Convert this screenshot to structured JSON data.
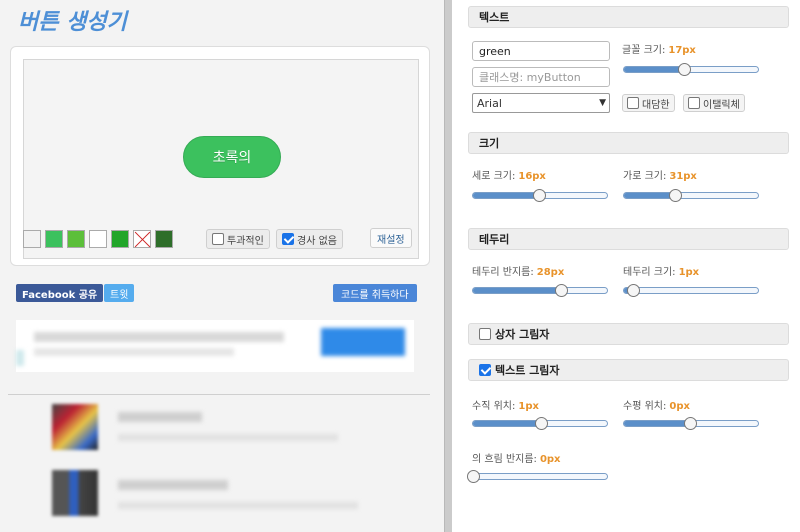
{
  "app": {
    "title": "버튼 생성기"
  },
  "preview": {
    "button_label": "초록의",
    "swatches": [
      "#f2f2f2",
      "#3cc15e",
      "#5cbf3a",
      "#ffffff",
      "#22a52a",
      "#ffffff",
      "#2e6e2a"
    ],
    "transparent_label": "투과적인",
    "no_gradient_label": "경사 없음",
    "reset_label": "재설정"
  },
  "share": {
    "facebook_label": "Facebook 공유",
    "tweet_label": "트윗",
    "get_code_label": "코드를 취득하다"
  },
  "text_section": {
    "header": "텍스트",
    "text_value": "green",
    "class_placeholder": "클래스명: myButton",
    "font_select": "Arial",
    "font_size_label": "글꼴 크기:",
    "font_size_value": "17px",
    "font_size_level": 0.45,
    "bold_label": "대담한",
    "italic_label": "이탤릭체"
  },
  "size_section": {
    "header": "크기",
    "vertical_label": "세로 크기:",
    "vertical_value": "16px",
    "vertical_level": 0.49,
    "horizontal_label": "가로 크기:",
    "horizontal_value": "31px",
    "horizontal_level": 0.38
  },
  "border_section": {
    "header": "테두리",
    "radius_label": "테두리 반지름:",
    "radius_value": "28px",
    "radius_level": 0.66,
    "width_label": "테두리 크기:",
    "width_value": "1px",
    "width_level": 0.07
  },
  "box_shadow_section": {
    "header": "상자 그림자",
    "checked": false
  },
  "text_shadow_section": {
    "header": "텍스트 그림자",
    "checked": true,
    "vertical_label": "수직 위치:",
    "vertical_value": "1px",
    "vertical_level": 0.51,
    "horizontal_label": "수평 위치:",
    "horizontal_value": "0px",
    "horizontal_level": 0.49,
    "blur_label": "의 흐림 반지름:",
    "blur_value": "0px",
    "blur_level": 0.0
  }
}
